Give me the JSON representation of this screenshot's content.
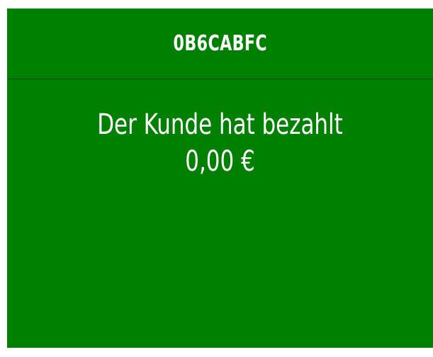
{
  "panel": {
    "title": "0B6CABFC",
    "status_message": "Der Kunde hat bezahlt",
    "amount": "0,00 €",
    "background_color": "#008000"
  }
}
